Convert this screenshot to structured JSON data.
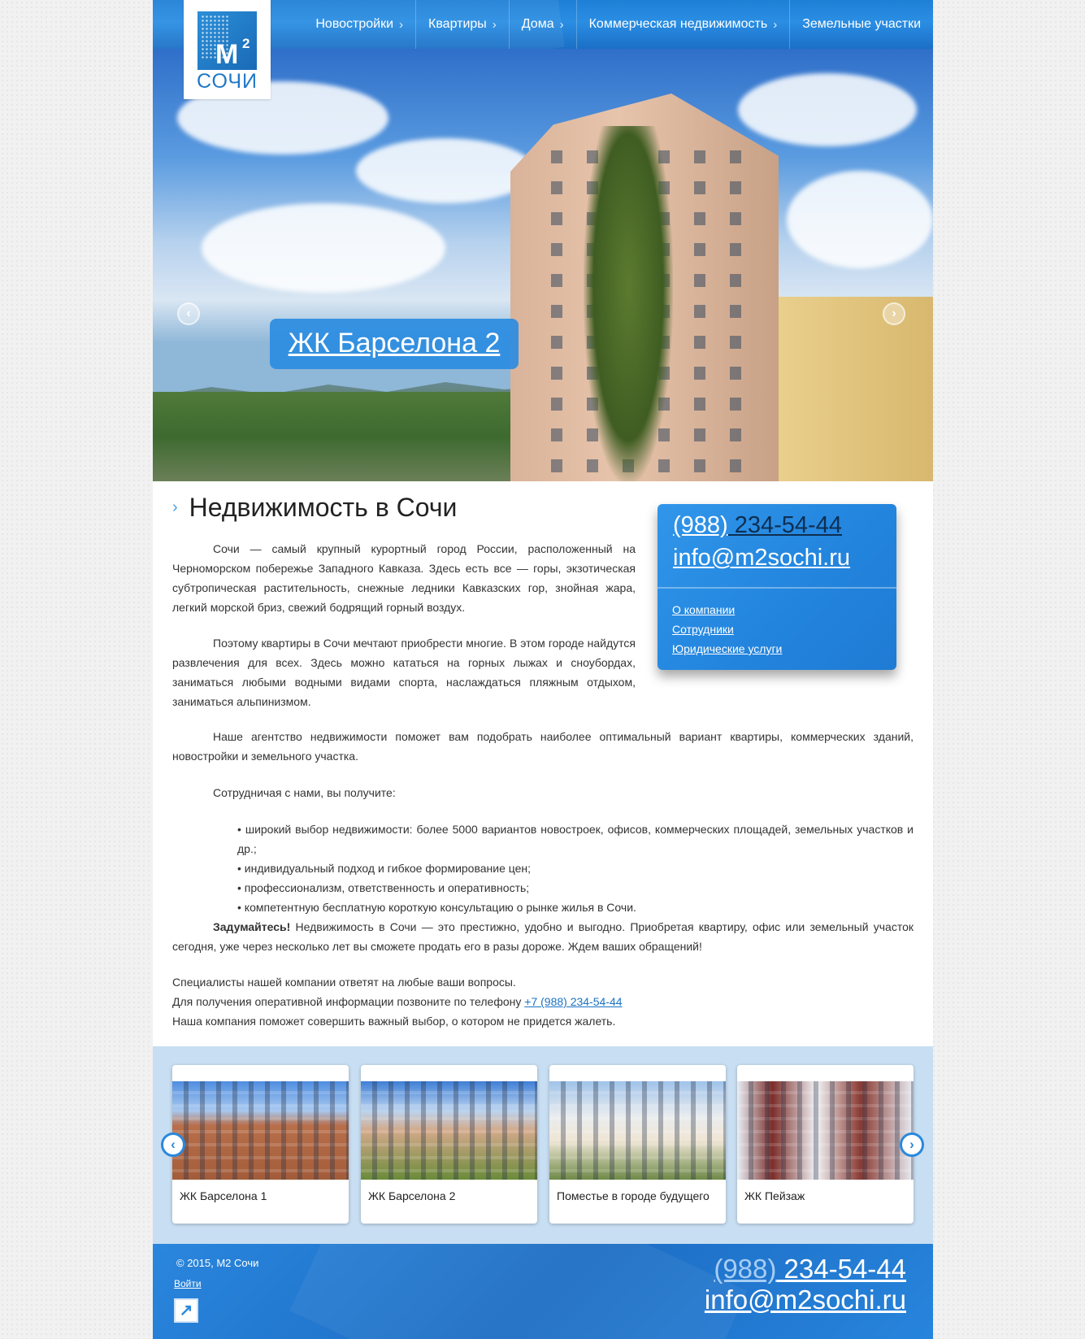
{
  "header": {
    "logo": {
      "mark": "M",
      "superscript": "2",
      "city": "СОЧИ"
    },
    "nav": [
      {
        "label": "Новостройки",
        "icon": "chevron-right-icon"
      },
      {
        "label": "Квартиры",
        "icon": "chevron-right-icon"
      },
      {
        "label": "Дома",
        "icon": "chevron-right-icon"
      },
      {
        "label": "Коммерческая недвижимость",
        "icon": "chevron-right-icon"
      },
      {
        "label": "Земельные участки"
      }
    ]
  },
  "hero": {
    "caption": "ЖК Барселона 2",
    "prev_icon": "arrow-left-icon",
    "next_icon": "arrow-right-icon"
  },
  "main": {
    "title": "Недвижимость в Сочи",
    "paragraphs": [
      "Сочи — самый крупный курортный город России, расположенный на Черноморском побережье Западного Кавказа. Здесь есть все — горы, экзотическая субтропическая растительность, снежные ледники Кавказских гор, знойная жара, легкий морской бриз, свежий бодрящий горный воздух.",
      "Поэтому квартиры в Сочи мечтают приобрести многие. В этом городе найдутся развлечения для всех. Здесь можно кататься на горных лыжах и сноубордах, заниматься любыми водными видами спорта, наслаждаться пляжным отдыхом, заниматься альпинизмом.",
      "Наше агентство недвижимости поможет вам подобрать наиболее оптимальный вариант квартиры, коммерческих зданий, новостройки и земельного участка.",
      "Сотрудничая с нами, вы получите:"
    ],
    "bullets": [
      "• широкий выбор недвижимости: более 5000 вариантов новостроек, офисов, коммерческих площадей, земельных участков и др.;",
      "• индивидуальный подход и гибкое формирование цен;",
      "• профессионализм, ответственность и оперативность;",
      "• компетентную бесплатную короткую консультацию о рынке жилья в Сочи."
    ],
    "think_bold": "Задумайтесь!",
    "think_text": " Недвижимость в Сочи — это престижно, удобно и выгодно. Приобретая квартиру, офис или земельный участок сегодня, уже через несколько лет вы сможете продать его в разы дороже. Ждем ваших обращений!",
    "closing_line1": "Специалисты нашей компании ответят на любые ваши вопросы.",
    "closing_line2": "Для получения оперативной информации позвоните по телефону ",
    "closing_phone": "+7 (988) 234-54-44",
    "closing_line3": "Наша компания поможет совершить важный выбор, о котором не придется жалеть."
  },
  "contact_box": {
    "phone_code": "(988)",
    "phone_number": " 234-54-44",
    "email": "info@m2sochi.ru",
    "links": [
      "О компании",
      "Сотрудники",
      "Юридические услуги"
    ]
  },
  "carousel": {
    "prev_icon": "arrow-left-icon",
    "next_icon": "arrow-right-icon",
    "cards": [
      {
        "title": "ЖК Барселона 1"
      },
      {
        "title": "ЖК Барселона 2"
      },
      {
        "title": "Поместье в городе будущего"
      },
      {
        "title": "ЖК Пейзаж"
      }
    ]
  },
  "footer": {
    "copyright": "© 2015, М2 Сочи",
    "login": "Войти",
    "ext_icon": "external-link-icon",
    "phone_code": "(988)",
    "phone_number": " 234-54-44",
    "email": "info@m2sochi.ru"
  },
  "colors": {
    "brand_blue": "#2385de",
    "page_bg": "#f1f1f1",
    "band_bg": "#c8def2",
    "link": "#1a73c4"
  }
}
